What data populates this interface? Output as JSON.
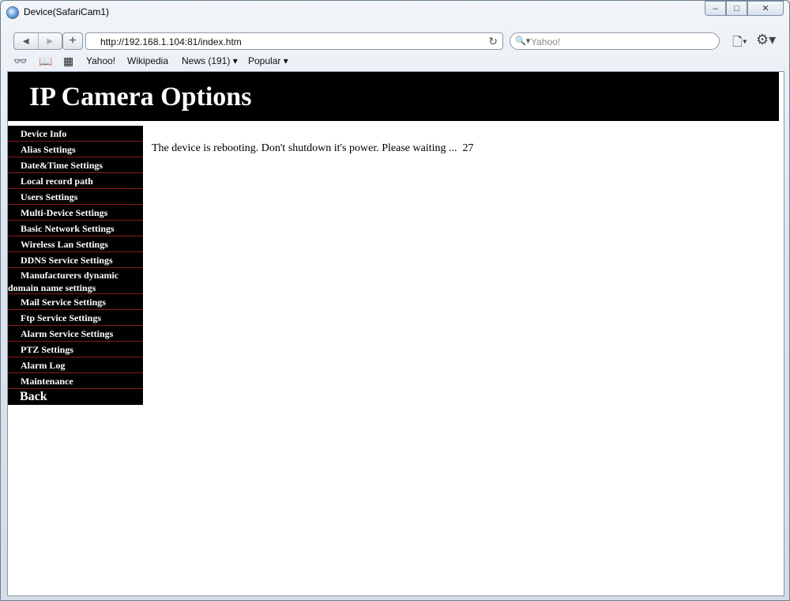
{
  "window": {
    "title": "Device(SafariCam1)",
    "controls": {
      "minimize": "–",
      "maximize": "□",
      "close": "✕"
    }
  },
  "toolbar": {
    "back_glyph": "◀",
    "forward_glyph": "▶",
    "add_glyph": "+",
    "url": "http://192.168.1.104:81/index.htm",
    "reload_glyph": "↻",
    "search_placeholder": "Yahoo!",
    "search_glyph": "🔍▾",
    "page_menu_glyph": "🗋▾",
    "settings_glyph": "⚙▾"
  },
  "bookmarks": {
    "reading_list_glyph": "👓",
    "book_glyph": "📖",
    "top_sites_glyph": "▦",
    "items": [
      "Yahoo!",
      "Wikipedia",
      "News (191) ▾",
      "Popular ▾"
    ]
  },
  "page": {
    "header_title": "IP Camera Options",
    "menu": [
      "Device Info",
      "Alias Settings",
      "Date&Time Settings",
      "Local record path",
      "Users Settings",
      "Multi-Device Settings",
      "Basic Network Settings",
      "Wireless Lan Settings",
      "DDNS Service Settings",
      "Manufacturers dynamic domain name settings",
      "Mail Service Settings",
      "Ftp Service Settings",
      "Alarm Service Settings",
      "PTZ Settings",
      "Alarm Log",
      "Maintenance"
    ],
    "back_label": "Back",
    "message": "The device is rebooting. Don't shutdown it's power. Please waiting ...  27"
  }
}
